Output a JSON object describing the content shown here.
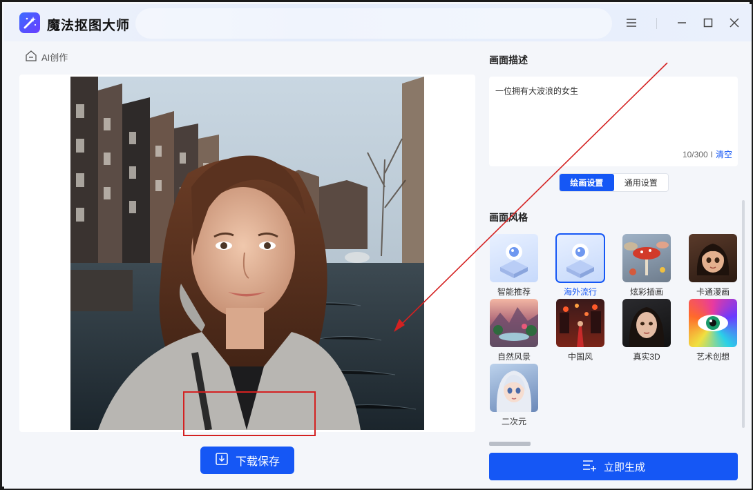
{
  "app": {
    "title": "魔法抠图大师",
    "icons": {
      "logo": "magic-wand-icon",
      "menu": "hamburger-icon",
      "minimize": "minimize-icon",
      "maximize": "maximize-icon",
      "close": "close-icon"
    }
  },
  "left": {
    "breadcrumb_label": "AI创作",
    "breadcrumb_icon": "home-back-icon",
    "download_label": "下载保存",
    "download_icon": "download-icon"
  },
  "right": {
    "description_title": "画面描述",
    "description_text": "一位拥有大波浪的女生",
    "counter": "10/300",
    "counter_sep": "I",
    "clear_label": "清空",
    "tabs": [
      {
        "label": "绘画设置",
        "active": true
      },
      {
        "label": "通用设置",
        "active": false
      }
    ],
    "style_title": "画面风格",
    "styles": [
      {
        "label": "智能推荐",
        "selected": false
      },
      {
        "label": "海外流行",
        "selected": true
      },
      {
        "label": "炫彩插画",
        "selected": false
      },
      {
        "label": "卡通漫画",
        "selected": false
      },
      {
        "label": "自然风景",
        "selected": false
      },
      {
        "label": "中国风",
        "selected": false
      },
      {
        "label": "真实3D",
        "selected": false
      },
      {
        "label": "艺术创想",
        "selected": false
      },
      {
        "label": "二次元",
        "selected": false
      }
    ],
    "generate_label": "立即生成",
    "generate_icon": "list-add-icon"
  },
  "colors": {
    "accent": "#1557f5",
    "annotation": "#d42121",
    "panel_bg": "#f4f6fa"
  }
}
